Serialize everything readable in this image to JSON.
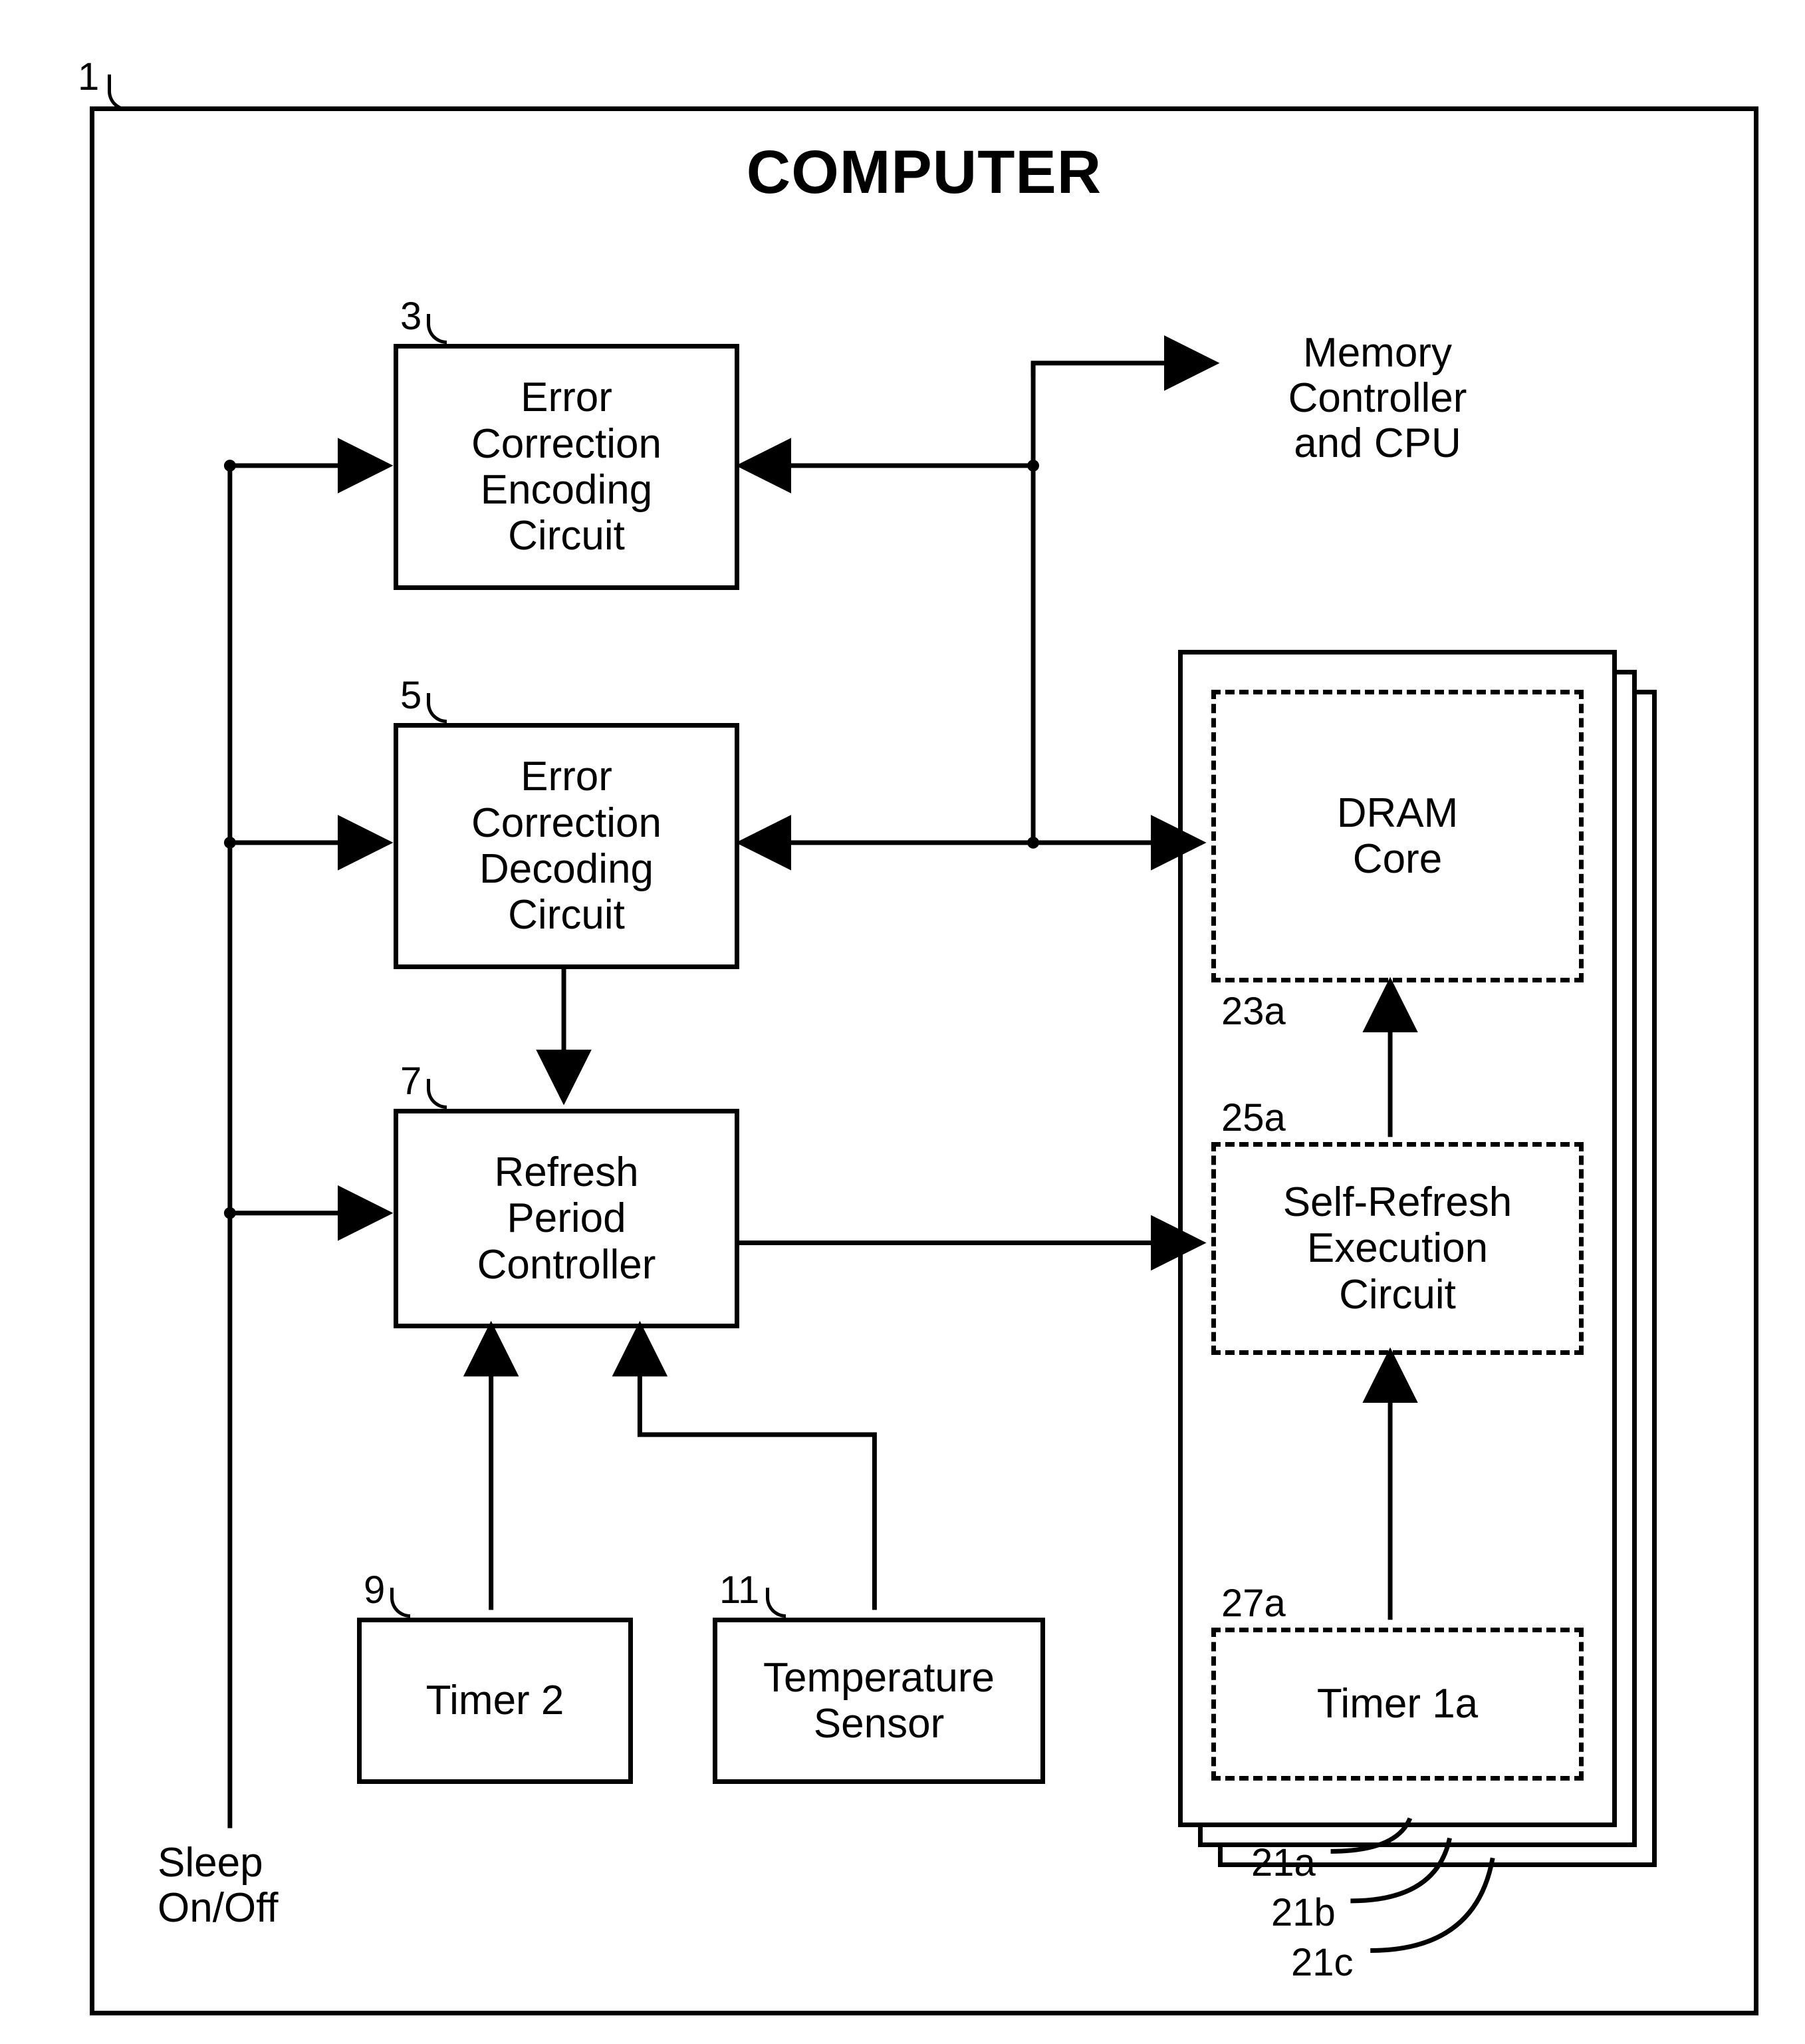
{
  "title": "COMPUTER",
  "refs": {
    "outer": "1",
    "ecEncode": "3",
    "ecDecode": "5",
    "refreshCtrl": "7",
    "timer2": "9",
    "tempSensor": "11",
    "dramCore": "23a",
    "selfRefresh": "25a",
    "timer1a": "27a",
    "chip_a": "21a",
    "chip_b": "21b",
    "chip_c": "21c"
  },
  "boxes": {
    "ecEncode": "Error\nCorrection\nEncoding\nCircuit",
    "ecDecode": "Error\nCorrection\nDecoding\nCircuit",
    "refreshCtrl": "Refresh\nPeriod\nController",
    "timer2": "Timer 2",
    "tempSensor": "Temperature\nSensor",
    "dramCore": "DRAM\nCore",
    "selfRefresh": "Self-Refresh\nExecution\nCircuit",
    "timer1a": "Timer 1a"
  },
  "labels": {
    "memCtrlCpu": "Memory\nController\nand CPU",
    "sleep": "Sleep\nOn/Off"
  }
}
